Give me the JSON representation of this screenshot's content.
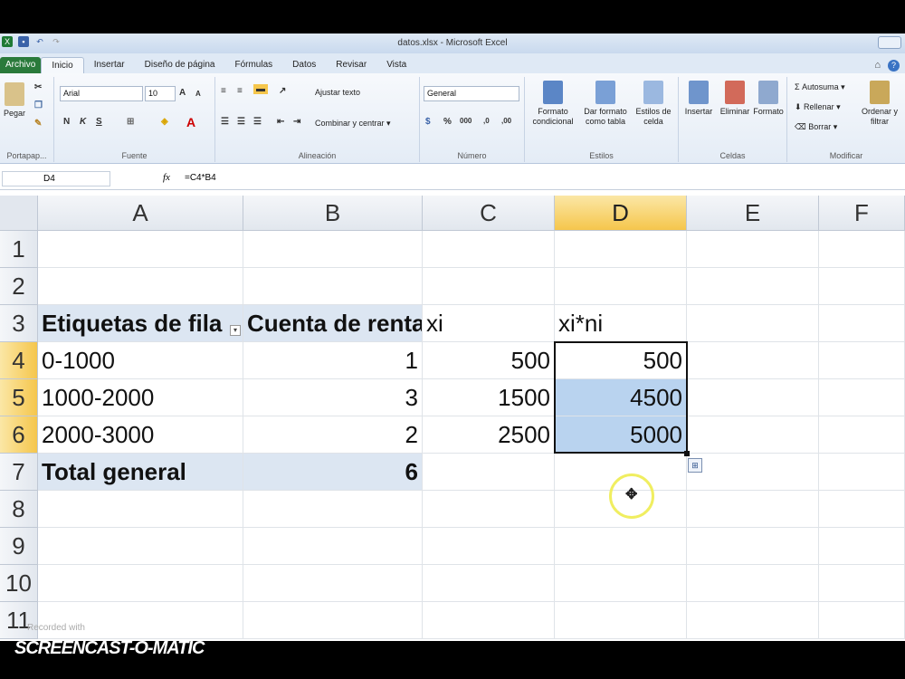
{
  "window": {
    "title": "datos.xlsx - Microsoft Excel"
  },
  "tabs": [
    {
      "label": "Archivo"
    },
    {
      "label": "Inicio"
    },
    {
      "label": "Insertar"
    },
    {
      "label": "Diseño de página"
    },
    {
      "label": "Fórmulas"
    },
    {
      "label": "Datos"
    },
    {
      "label": "Revisar"
    },
    {
      "label": "Vista"
    }
  ],
  "ribbon": {
    "clipboard": {
      "paste": "Pegar",
      "group": "Portapap..."
    },
    "font": {
      "name": "Arial",
      "size": "10",
      "group": "Fuente",
      "bold": "N",
      "italic": "K",
      "underline": "S"
    },
    "alignment": {
      "wrap": "Ajustar texto",
      "merge": "Combinar y centrar",
      "group": "Alineación"
    },
    "number": {
      "format": "General",
      "group": "Número"
    },
    "styles": {
      "conditional": "Formato condicional",
      "table": "Dar formato como tabla",
      "cell": "Estilos de celda",
      "group": "Estilos"
    },
    "cells": {
      "insert": "Insertar",
      "delete": "Eliminar",
      "format": "Formato",
      "group": "Celdas"
    },
    "editing": {
      "autosum": "Autosuma",
      "fill": "Rellenar",
      "clear": "Borrar",
      "sort": "Ordenar y filtrar",
      "group": "Modificar"
    }
  },
  "formula_bar": {
    "name_box": "D4",
    "fx": "fx",
    "formula": "=C4*B4"
  },
  "columns": [
    "A",
    "B",
    "C",
    "D",
    "E",
    "F"
  ],
  "rows": [
    "1",
    "2",
    "3",
    "4",
    "5",
    "6",
    "7",
    "8",
    "9",
    "10",
    "11"
  ],
  "cells": {
    "A3": "Etiquetas de fila",
    "B3": "Cuenta de renta",
    "C3": "xi",
    "D3": "xi*ni",
    "A4": "0-1000",
    "B4": "1",
    "C4": "500",
    "D4": "500",
    "A5": "1000-2000",
    "B5": "3",
    "C5": "1500",
    "D5": "4500",
    "A6": "2000-3000",
    "B6": "2",
    "C6": "2500",
    "D6": "5000",
    "A7": "Total general",
    "B7": "6"
  },
  "overlay": {
    "recorded_with": "Recorded with",
    "watermark": "SCREENCAST-O-MATIC"
  }
}
